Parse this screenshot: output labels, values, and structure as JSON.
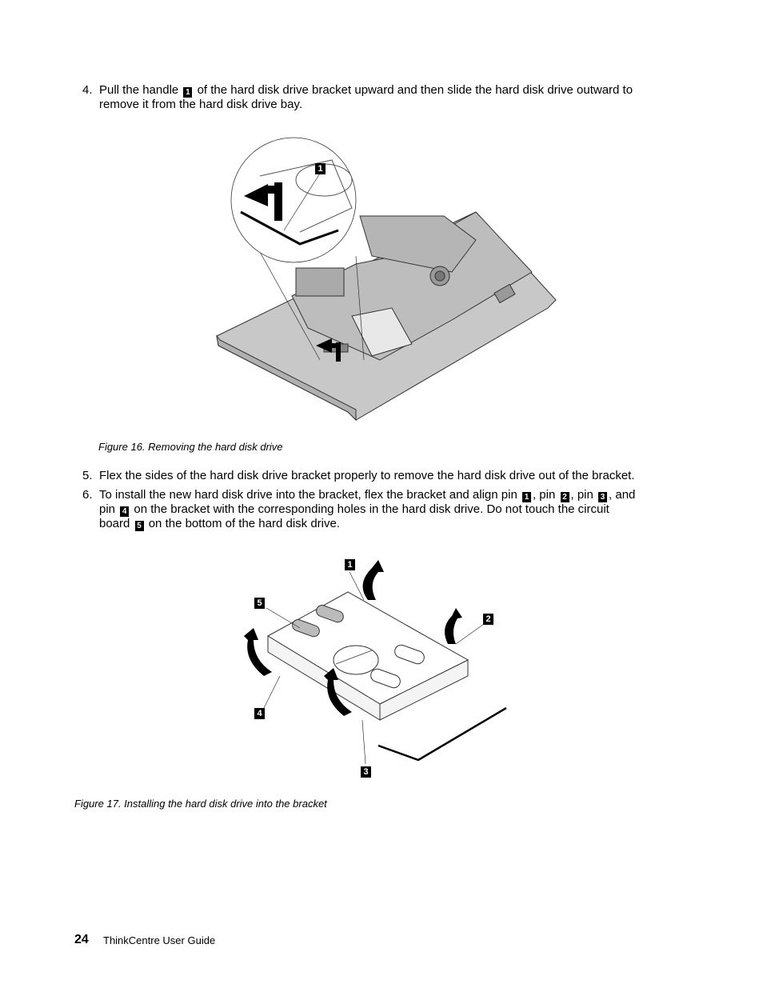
{
  "steps": [
    {
      "number": "4.",
      "segments": [
        "Pull the handle ",
        {
          "callout": "1"
        },
        " of the hard disk drive bracket upward and then slide the hard disk drive outward to"
      ],
      "line2": "remove it from the hard disk drive bay."
    },
    {
      "number": "5.",
      "text": "Flex the sides of the hard disk drive bracket properly to remove the hard disk drive out of the bracket."
    },
    {
      "number": "6.",
      "line1_a": "To install the new hard disk drive into the bracket, flex the bracket and align pin ",
      "line1_b": ", pin ",
      "line1_c": ", pin ",
      "line1_d": ", and",
      "line2_a": "pin ",
      "line2_b": " on the bracket with the corresponding holes in the hard disk drive.  Do not touch the circuit",
      "line3_a": "board ",
      "line3_b": " on the bottom of the hard disk drive."
    }
  ],
  "callouts": {
    "c1": "1",
    "c2": "2",
    "c3": "3",
    "c4": "4",
    "c5": "5"
  },
  "figures": [
    {
      "caption": "Figure 16.  Removing the hard disk drive",
      "labels": [
        "1"
      ]
    },
    {
      "caption": "Figure 17.  Installing the hard disk drive into the bracket",
      "labels": [
        "1",
        "2",
        "3",
        "4",
        "5"
      ]
    }
  ],
  "footer": {
    "page_number": "24",
    "title": "ThinkCentre User Guide"
  }
}
